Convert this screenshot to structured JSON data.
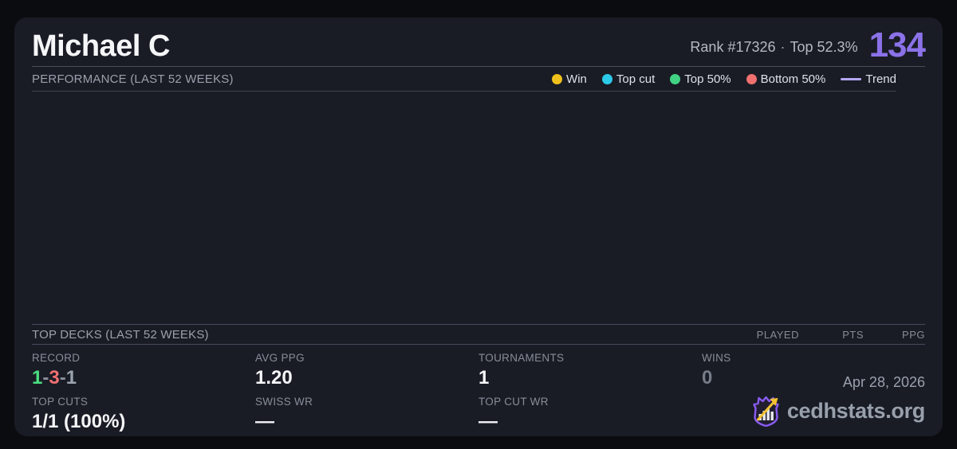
{
  "header": {
    "player_name": "Michael C",
    "rank_label": "Rank #17326",
    "separator": "·",
    "top_percent": "Top 52.3%",
    "score": "134"
  },
  "performance": {
    "title": "PERFORMANCE (LAST 52 WEEKS)",
    "legend": [
      {
        "label": "Win",
        "color": "#f0c11d",
        "marker": "dot"
      },
      {
        "label": "Top cut",
        "color": "#2cc9e8",
        "marker": "dot"
      },
      {
        "label": "Top 50%",
        "color": "#41d283",
        "marker": "dot"
      },
      {
        "label": "Bottom 50%",
        "color": "#f07070",
        "marker": "dot"
      },
      {
        "label": "Trend",
        "color": "#b5a6f2",
        "marker": "line"
      }
    ],
    "chart_empty": true
  },
  "top_decks": {
    "title": "TOP DECKS (LAST 52 WEEKS)",
    "columns": [
      "PLAYED",
      "PTS",
      "PPG"
    ],
    "rows": []
  },
  "stats": {
    "record": {
      "label": "RECORD",
      "parts": [
        {
          "text": "1",
          "color": "#4ade80"
        },
        {
          "text": "-",
          "color": "#8a8f9b"
        },
        {
          "text": "3",
          "color": "#f07070"
        },
        {
          "text": "-",
          "color": "#8a8f9b"
        },
        {
          "text": "1",
          "color": "#9aa3ae"
        }
      ]
    },
    "avg_ppg": {
      "label": "AVG PPG",
      "value": "1.20"
    },
    "tournaments": {
      "label": "TOURNAMENTS",
      "value": "1"
    },
    "wins": {
      "label": "WINS",
      "value": "0",
      "muted_color": "#767c88"
    },
    "top_cuts": {
      "label": "TOP CUTS",
      "value": "1/1 (100%)"
    },
    "swiss_wr": {
      "label": "SWISS WR",
      "value": "—"
    },
    "top_cut_wr": {
      "label": "TOP CUT WR",
      "value": "—"
    }
  },
  "footer": {
    "date": "Apr 28, 2026",
    "brand": "cedhstats.org",
    "logo": "shield-barchart-arrow-icon"
  },
  "colors": {
    "page_background": "#0b0c10",
    "card_background": "#191c25",
    "accent_purple": "#8b72e8",
    "divider": "#464c5c",
    "label_gray": "#878d99",
    "value_white": "#f4f5f7",
    "logo_shield": "#8a5cf5",
    "logo_arrow": "#f2c230"
  }
}
